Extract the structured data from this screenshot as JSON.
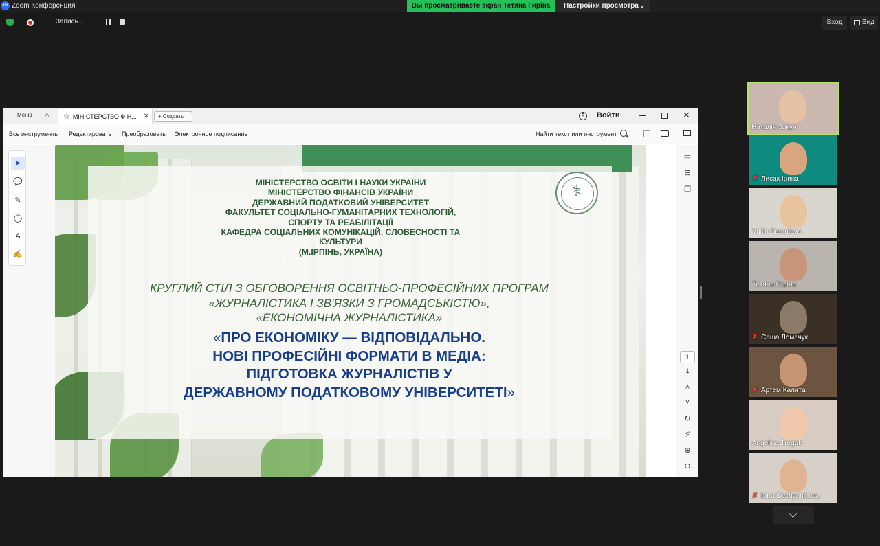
{
  "titlebar": {
    "logo_text": "zm",
    "app_title": "Zoom Конференция",
    "share_banner": "Вы просматриваете экран Тетяна Гиріна",
    "view_settings": "Настройки просмотра",
    "view_settings_chevron": "⌄"
  },
  "toolbar": {
    "recording_label": "Запись...",
    "login_label": "Вход",
    "view_label": "Вид"
  },
  "window": {
    "menu_label": "Меню",
    "tab_title": "МІНІСТЕРСТВО ФІН...",
    "tab_close": "✕",
    "new_label": "Создать",
    "new_plus": "+",
    "help_glyph": "?",
    "signin_label": "Войти",
    "close_glyph": "✕",
    "menus": [
      "Все инструменты",
      "Редактировать",
      "Преобразовать",
      "Электронное подписание"
    ],
    "find_label": "Найти текст или инструмент",
    "page_current": "1",
    "page_total": "1",
    "icons": {
      "home": "⌂",
      "star": "☆",
      "cursor": "➤",
      "comment": "💬",
      "pen": "✎",
      "lasso": "◯",
      "text": "A",
      "sign": "✍",
      "comments_panel": "▭",
      "bookmark": "⊟",
      "pages": "❐",
      "up": "˄",
      "down": "˅",
      "rotate": "↻",
      "extract": "⎘",
      "zoom_in": "⊕",
      "zoom_out": "⊖"
    }
  },
  "slide": {
    "institution_lines": [
      "МІНІСТЕРСТВО ОСВІТИ І НАУКИ УКРАЇНИ",
      "МІНІСТЕРСТВО ФІНАНСІВ УКРАЇНИ",
      "ДЕРЖАВНИЙ ПОДАТКОВИЙ УНІВЕРСИТЕТ",
      "ФАКУЛЬТЕТ СОЦІАЛЬНО-ГУМАНІТАРНИХ ТЕХНОЛОГІЙ,",
      "СПОРТУ ТА РЕАБІЛІТАЦІЇ",
      "КАФЕДРА СОЦІАЛЬНИХ КОМУНІКАЦІЙ, СЛОВЕСНОСТІ ТА",
      "КУЛЬТУРИ",
      "(М.ІРПІНЬ, УКРАЇНА)"
    ],
    "round_lines": [
      "КРУГЛИЙ СТІЛ З ОБГОВОРЕННЯ ОСВІТНЬО-ПРОФЕСІЙНИХ ПРОГРАМ",
      "«ЖУРНАЛІСТИКА І ЗВ'ЯЗКИ З ГРОМАДСЬКІСТЮ»,",
      "«ЕКОНОМІЧНА ЖУРНАЛІСТИКА»"
    ],
    "headline_open": "«",
    "headline_lines": [
      "ПРО ЕКОНОМІКУ — ВІДПОВІДАЛЬНО.",
      "НОВІ ПРОФЕСІЙНІ ФОРМАТИ В МЕДІА:",
      "ПІДГОТОВКА ЖУРНАЛІСТІВ У",
      "ДЕРЖАВНОМУ ПОДАТКОВОМУ УНІВЕРСИТЕТІ"
    ],
    "headline_close": "»"
  },
  "participants": [
    {
      "name": "Наталія Зикун",
      "muted": false,
      "active": true,
      "bg": "#c9b7b0",
      "face": "#e6c2a4"
    },
    {
      "name": "Лисак Ірина",
      "muted": true,
      "active": false,
      "bg": "#0f8a7e",
      "face": "#d9a57f"
    },
    {
      "name": "Yuliia Samaieva",
      "muted": false,
      "active": false,
      "bg": "#d9d6cf",
      "face": "#e7c39f"
    },
    {
      "name": "Тетяна Гиріна",
      "muted": false,
      "active": false,
      "bg": "#b9b4ad",
      "face": "#c9957a"
    },
    {
      "name": "Саша Ломачук",
      "muted": true,
      "active": false,
      "bg": "#3a3026",
      "face": "#8b7a68"
    },
    {
      "name": "Артем Калита",
      "muted": true,
      "active": false,
      "bg": "#6b5541",
      "face": "#c49473"
    },
    {
      "name": "Angelina Tregub",
      "muted": false,
      "active": false,
      "bg": "#d8cbc2",
      "face": "#f0c9ad"
    },
    {
      "name": "Inna Ovchynnikova",
      "muted": true,
      "active": false,
      "bg": "#d7d0c8",
      "face": "#e0b393"
    }
  ],
  "colors": {
    "share_green": "#25c05a",
    "active_border": "#b7e36a",
    "headline_blue": "#173f8e",
    "institution_green": "#2e5a36"
  }
}
